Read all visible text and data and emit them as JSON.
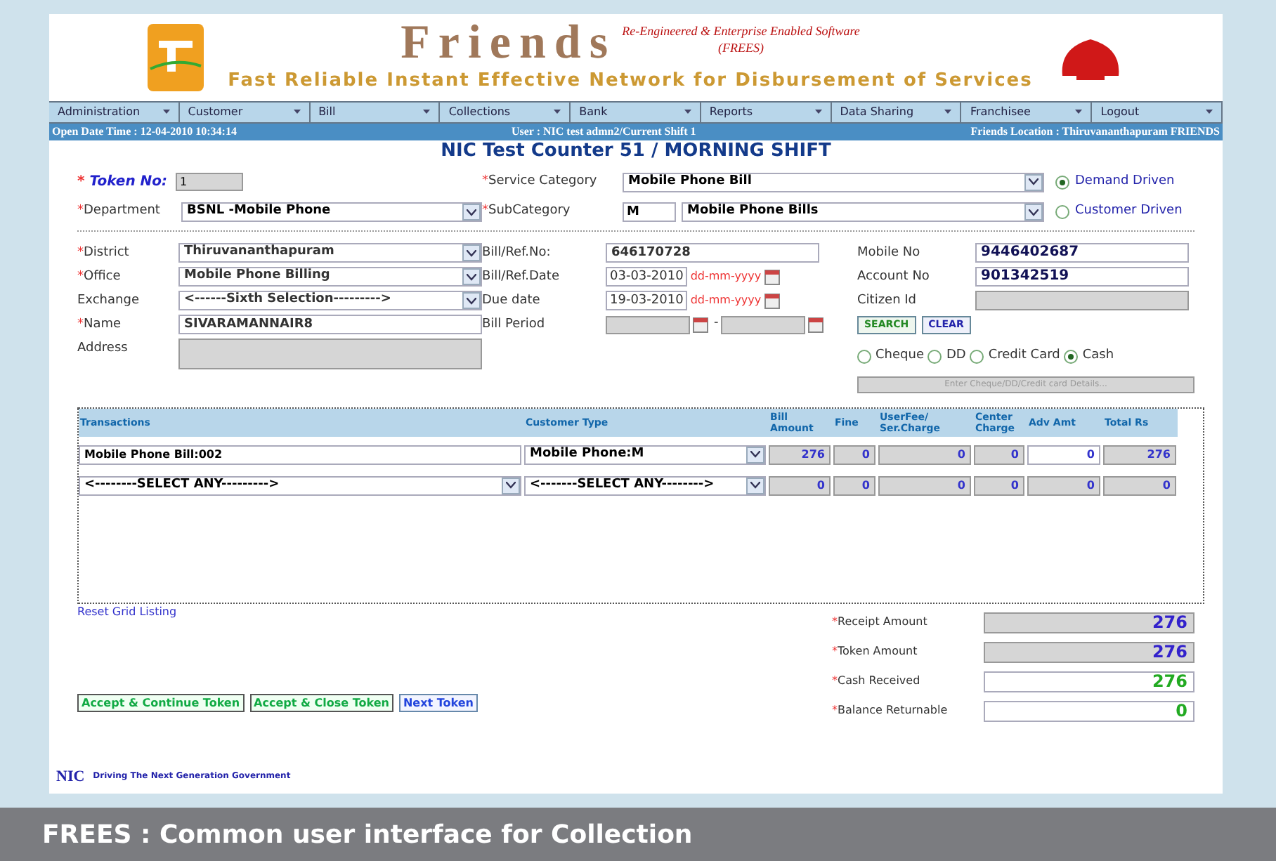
{
  "header": {
    "title": "Friends",
    "subtitle": "Re-Engineered & Enterprise Enabled Software",
    "acronym": "(FREES)",
    "tagline": "Fast Reliable Instant Effective Network for Disbursement of Services"
  },
  "menu": [
    "Administration",
    "Customer",
    "Bill",
    "Collections",
    "Bank",
    "Reports",
    "Data Sharing",
    "Franchisee",
    "Logout"
  ],
  "status_bar": {
    "open_date": "Open Date Time : 12-04-2010 10:34:14",
    "user": "User : NIC test admn2/Current Shift 1",
    "location": "Friends Location : Thiruvananthapuram FRIENDS"
  },
  "heading": "NIC Test Counter 51 / MORNING SHIFT",
  "token": {
    "mark": "*",
    "label": "Token No:",
    "value": "1"
  },
  "service_category": {
    "mark": "*",
    "label": "Service Category",
    "value": "Mobile Phone Bill"
  },
  "department": {
    "mark": "*",
    "label": "Department",
    "value": "BSNL -Mobile Phone"
  },
  "subcategory": {
    "mark": "*",
    "label": "SubCategory",
    "code": "M",
    "value": "Mobile Phone Bills"
  },
  "drive_options": [
    {
      "label": "Demand Driven",
      "selected": true
    },
    {
      "label": "Customer Driven",
      "selected": false
    }
  ],
  "left_fields": [
    {
      "mark": "*",
      "label": "District",
      "kind": "select",
      "value": "Thiruvananthapuram"
    },
    {
      "mark": "*",
      "label": "Office",
      "kind": "select",
      "value": "Mobile Phone Billing"
    },
    {
      "label": "Exchange",
      "kind": "select",
      "value": "<------Sixth Selection--------->"
    },
    {
      "mark": "*",
      "label": "Name",
      "kind": "input",
      "value": "SIVARAMANNAIR8"
    },
    {
      "label": "Address",
      "kind": "textarea"
    }
  ],
  "middle_fields": [
    {
      "label": "Bill/Ref.No:",
      "kind": "input",
      "value": "646170728"
    },
    {
      "label": "Bill/Ref.Date",
      "kind": "date",
      "value": "03-03-2010",
      "hint": "dd-mm-yyyy"
    },
    {
      "label": "Due date",
      "kind": "date",
      "value": "19-03-2010",
      "hint": "dd-mm-yyyy"
    },
    {
      "label": "Bill Period",
      "kind": "range",
      "separator": "-"
    }
  ],
  "right_fields": [
    {
      "label": "Mobile No",
      "value": "9446402687",
      "disabled": false
    },
    {
      "label": "Account No",
      "value": "901342519",
      "disabled": false
    },
    {
      "label": "Citizen Id",
      "disabled": true
    }
  ],
  "search_button": "SEARCH",
  "clear_button": "CLEAR",
  "payment_modes": [
    {
      "label": "Cheque",
      "selected": false
    },
    {
      "label": "DD",
      "selected": false
    },
    {
      "label": "Credit Card",
      "selected": false
    },
    {
      "label": "Cash",
      "selected": true
    }
  ],
  "details_button": "Enter Cheque/DD/Credit card Details...",
  "grid": {
    "columns": [
      "Transactions",
      "Customer Type",
      "Bill Amount",
      "Fine",
      "UserFee/ Ser.Charge",
      "Center Charge",
      "Adv Amt",
      "Total Rs"
    ],
    "rows": [
      {
        "kind": "text",
        "transaction": "Mobile Phone Bill:002",
        "customer_type": "Mobile Phone:M",
        "amounts": [
          {
            "value": "276",
            "editable": false
          },
          {
            "value": "0",
            "editable": false
          },
          {
            "value": "0",
            "editable": false
          },
          {
            "value": "0",
            "editable": false
          },
          {
            "value": "0",
            "editable": true
          },
          {
            "value": "276",
            "editable": false
          }
        ]
      },
      {
        "kind": "select",
        "transaction": "<--------SELECT ANY--------->",
        "customer_type": "<-------SELECT ANY-------->",
        "amounts": [
          {
            "value": "0",
            "editable": false
          },
          {
            "value": "0",
            "editable": false
          },
          {
            "value": "0",
            "editable": false
          },
          {
            "value": "0",
            "editable": false
          },
          {
            "value": "0",
            "editable": false
          },
          {
            "value": "0",
            "editable": false
          }
        ]
      }
    ]
  },
  "reset_link": "Reset Grid Listing",
  "totals": [
    {
      "mark": "*",
      "label": "Receipt Amount",
      "value": "276",
      "readonly": true,
      "color": "#3322cc"
    },
    {
      "mark": "*",
      "label": "Token Amount",
      "value": "276",
      "readonly": true,
      "color": "#3322cc"
    },
    {
      "mark": "*",
      "label": "Cash Received",
      "value": "276",
      "readonly": false,
      "color": "#22aa22"
    },
    {
      "mark": "*",
      "label": "Balance Returnable",
      "value": "0",
      "readonly": false,
      "color": "#22aa22"
    }
  ],
  "actions": [
    {
      "label": "Accept & Continue Token",
      "kind": "accept"
    },
    {
      "label": "Accept & Close Token",
      "kind": "accept"
    },
    {
      "label": "Next Token",
      "kind": "next"
    }
  ],
  "footer": {
    "logo": "NIC",
    "slogan": "Driving The Next Generation Government"
  },
  "caption": "FREES : Common user interface for Collection"
}
